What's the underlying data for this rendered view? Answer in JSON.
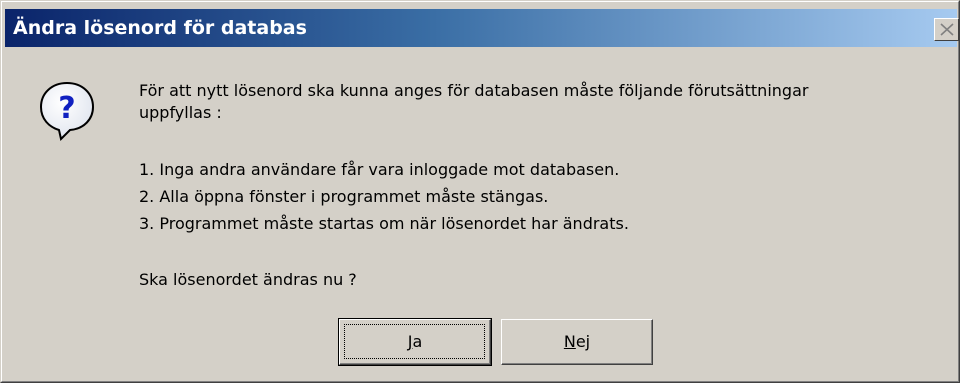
{
  "dialog": {
    "title": "Ändra lösenord för databas",
    "close_label": "X",
    "icon": "question-icon",
    "message": {
      "intro_line1": "För att nytt lösenord ska kunna anges för databasen måste följande förutsättningar",
      "intro_line2": "uppfyllas :",
      "conditions": [
        "1. Inga andra användare får vara inloggade mot databasen.",
        "2. Alla öppna fönster i programmet måste stängas.",
        "3. Programmet måste startas om när lösenordet har ändrats."
      ],
      "question": "Ska lösenordet ändras nu ?"
    },
    "buttons": {
      "yes_mnemonic": "J",
      "yes_rest": "a",
      "no_mnemonic": "N",
      "no_rest": "ej"
    }
  },
  "colors": {
    "face": "#d4d0c8",
    "title_start": "#0a246a",
    "title_end": "#a6caf0"
  }
}
